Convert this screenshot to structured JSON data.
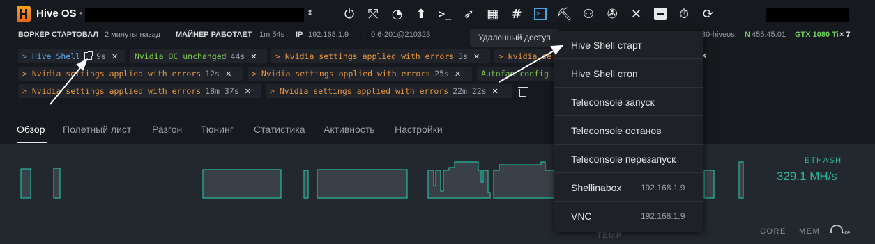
{
  "app": {
    "brand": "Hive OS",
    "separator": "•",
    "selector_arrows": "⇕"
  },
  "toolbar_icons": [
    {
      "name": "power-icon",
      "glyph": "⏻"
    },
    {
      "name": "flash-icon",
      "glyph": "⤲"
    },
    {
      "name": "overclock-icon",
      "glyph": "◔"
    },
    {
      "name": "upgrade-icon",
      "glyph": "⬆"
    },
    {
      "name": "command-icon",
      "glyph": ">_"
    },
    {
      "name": "rocket-icon",
      "glyph": "➶"
    },
    {
      "name": "ram-icon",
      "glyph": "▦"
    },
    {
      "name": "hash-icon",
      "glyph": "#"
    },
    {
      "name": "terminal-icon",
      "glyph": ">_"
    },
    {
      "name": "pickaxe-icon",
      "glyph": "⛏"
    },
    {
      "name": "network-icon",
      "glyph": "⚇"
    },
    {
      "name": "fan-icon",
      "glyph": "✇"
    },
    {
      "name": "tools-icon",
      "glyph": "✕"
    },
    {
      "name": "minus-box-icon",
      "glyph": ""
    },
    {
      "name": "stopwatch-icon",
      "glyph": "⏱"
    },
    {
      "name": "refresh-icon",
      "glyph": "⟳"
    }
  ],
  "status": {
    "worker_label": "ВОРКЕР СТАРТОВАЛ",
    "worker_value": "2 минуты назад",
    "miner_label": "МАЙНЕР РАБОТАЕТ",
    "miner_value": "1m 54s",
    "ip_label": "IP",
    "ip_value": "192.168.1.9",
    "version": "0.6-201@210323",
    "hostname_tail": "30-hiveos",
    "driver_prefix": "N",
    "driver_version": "455.45.01",
    "gpu_model": "GTX 1080 Ti",
    "gpu_count": "× 7"
  },
  "tooltip": {
    "text": "Удаленный доступ"
  },
  "tags": [
    {
      "text": "> Hive Shell",
      "time": "9s",
      "color": "blue",
      "external": true
    },
    {
      "text": "Nvidia OC unchanged",
      "time": "44s",
      "color": "green"
    },
    {
      "text": "> Nvidia settings applied with errors",
      "time": "3s",
      "color": "orange"
    },
    {
      "text": "> Nvidia se",
      "time": "",
      "color": "orange"
    },
    {
      "text": "> Nvidia settings applied with errors",
      "time": "12s",
      "color": "orange"
    },
    {
      "text": "> Nvidia settings applied with errors",
      "time": "25s",
      "color": "orange"
    },
    {
      "text": "Autofan config",
      "time": "",
      "color": "green"
    },
    {
      "text": "> Nvidia settings applied with errors",
      "time": "18m 37s",
      "color": "orange"
    },
    {
      "text": "> Nvidia settings applied with errors",
      "time": "22m 22s",
      "color": "orange"
    }
  ],
  "tabs": [
    "Обзор",
    "Полетный лист",
    "Разгон",
    "Тюнинг",
    "Статистика",
    "Активность",
    "Настройки"
  ],
  "active_tab": "Обзор",
  "graph": {
    "algo": "ETHASH",
    "hashrate": "329.1 MH/s",
    "footer_temp": "TEMP",
    "footer_core": "CORE",
    "footer_mem": "MEM",
    "footer_all": "Все",
    "line_color": "#28b6a0"
  },
  "menu": [
    {
      "label": "Hive Shell старт",
      "ip": ""
    },
    {
      "label": "Hive Shell стоп",
      "ip": ""
    },
    {
      "label": "Teleconsole запуск",
      "ip": ""
    },
    {
      "label": "Teleconsole останов",
      "ip": ""
    },
    {
      "label": "Teleconsole перезапуск",
      "ip": ""
    },
    {
      "label": "Shellinabox",
      "ip": "192.168.1.9"
    },
    {
      "label": "VNC",
      "ip": "192.168.1.9"
    }
  ]
}
